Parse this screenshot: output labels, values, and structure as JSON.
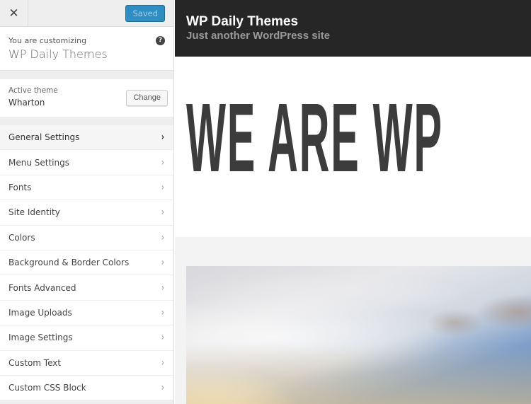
{
  "topbar": {
    "close_icon": "close-x-icon",
    "close_glyph": "✕",
    "saved_label": "Saved"
  },
  "customizing": {
    "label": "You are customizing",
    "site_name": "WP Daily Themes",
    "help_glyph": "?"
  },
  "theme": {
    "label": "Active theme",
    "name": "Wharton",
    "change_label": "Change"
  },
  "sections": [
    {
      "label": "General Settings",
      "active": true
    },
    {
      "label": "Menu Settings"
    },
    {
      "label": "Fonts"
    },
    {
      "label": "Site Identity"
    },
    {
      "label": "Colors"
    },
    {
      "label": "Background & Border Colors"
    },
    {
      "label": "Fonts Advanced"
    },
    {
      "label": "Image Uploads"
    },
    {
      "label": "Image Settings"
    },
    {
      "label": "Custom Text"
    },
    {
      "label": "Custom CSS Block"
    }
  ],
  "chevron_glyph": "›",
  "preview": {
    "site_title": "WP Daily Themes",
    "site_description": "Just another WordPress site",
    "hero_text": "WE ARE WP",
    "image": "sky-clouds-sunset-photo"
  },
  "colors": {
    "accent": "#2e8ec3",
    "header_bg": "#262626",
    "hero_text": "#3c3c3c"
  }
}
